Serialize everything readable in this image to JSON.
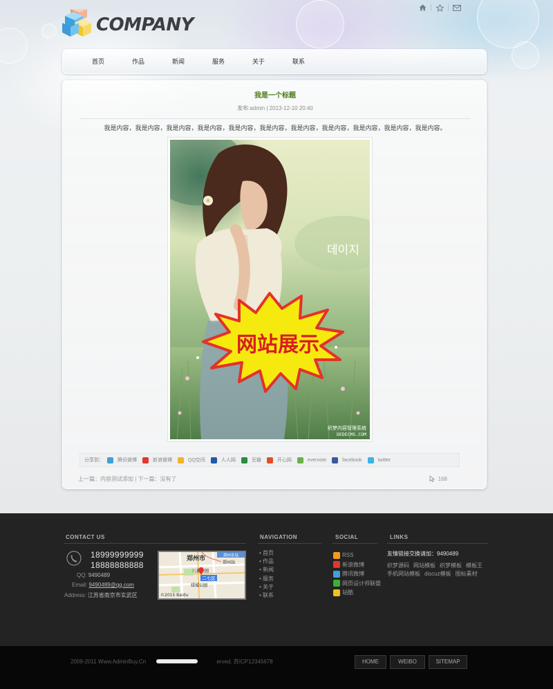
{
  "brand": {
    "name": "COMPANY"
  },
  "top_icons": [
    "home-icon",
    "star-icon",
    "mail-icon"
  ],
  "nav": {
    "items": [
      "首页",
      "作品",
      "新闻",
      "服务",
      "关于",
      "联系"
    ]
  },
  "article": {
    "title": "我是一个标题",
    "meta": "发布:admin | 2013-12-10 20:40",
    "body": "我是内容，我是内容，我是内容，我是内容，我是内容，我是内容，我是内容，我是内容，我是内容，我是内容，我是内容。",
    "image": {
      "korean_text": "데이지",
      "badge_text": "网站展示",
      "watermark_line1": "织梦内容管理系统",
      "watermark_line2": "DEDECMS.COM"
    }
  },
  "share": {
    "label": "分享到：",
    "items": [
      {
        "label": "腾讯微博",
        "icon": "tencent-weibo-icon",
        "color": "#3fa1d6"
      },
      {
        "label": "新浪微博",
        "icon": "sina-weibo-icon",
        "color": "#e0372f"
      },
      {
        "label": "QQ空间",
        "icon": "qzone-icon",
        "color": "#f2b22c"
      },
      {
        "label": "人人网",
        "icon": "renren-icon",
        "color": "#1f5aa6"
      },
      {
        "label": "豆瓣",
        "icon": "douban-icon",
        "color": "#2b8a3e"
      },
      {
        "label": "开心网",
        "icon": "kaixin-icon",
        "color": "#e34d2a"
      },
      {
        "label": "evernote",
        "icon": "evernote-icon",
        "color": "#6ab04c"
      },
      {
        "label": "facebook",
        "icon": "facebook-icon",
        "color": "#3b5998"
      },
      {
        "label": "twitter",
        "icon": "twitter-icon",
        "color": "#3fb1e6"
      }
    ]
  },
  "pager": {
    "text": "上一篇：内容测试添加 | 下一篇：没有了"
  },
  "views": {
    "count": "168"
  },
  "footer": {
    "contact": {
      "heading": "CONTACT US",
      "phone1": "18999999999",
      "phone2": "18888888888",
      "qq_label": "QQ:",
      "qq": "9490489",
      "email_label": "Email:",
      "email": "9490489@qq.com",
      "address_label": "Address:",
      "address": "江苏省南京市玄武区"
    },
    "map": {
      "city": "郑州市",
      "station": "郑州站",
      "park": "儿童公园",
      "district": "二七区",
      "park2": "绿城公园",
      "station_tag": "郑州东站",
      "copyright": "©2015 Baidu"
    },
    "navigation": {
      "heading": "NAVIGATION",
      "items": [
        "首页",
        "作品",
        "新闻",
        "服务",
        "关于",
        "联系"
      ]
    },
    "social": {
      "heading": "SOCIAL",
      "items": [
        {
          "label": "RSS",
          "icon": "rss-icon",
          "color": "#f29a1d"
        },
        {
          "label": "新浪微博",
          "icon": "sina-weibo-icon",
          "color": "#e0372f"
        },
        {
          "label": "腾讯微博",
          "icon": "tencent-weibo-icon",
          "color": "#3fa1d6"
        },
        {
          "label": "网页设计师联盟",
          "icon": "designer-union-icon",
          "color": "#3cae3a"
        },
        {
          "label": "站酷",
          "icon": "zcool-icon",
          "color": "#f1c21b"
        }
      ]
    },
    "links": {
      "heading": "LINKS",
      "intro": "友情链接交换请加：9490489",
      "row1": [
        "织梦源码",
        "网站模板",
        "织梦模板",
        "模板王"
      ],
      "row2": [
        "手机网站模板",
        "discuz模板",
        "图标素材"
      ]
    }
  },
  "bottom": {
    "copyright": "2009-2011 Www.AdminBuy.Cn                                              erved. 苏ICP12345678",
    "buttons": [
      "HOME",
      "WEIBO",
      "SITEMAP"
    ]
  }
}
